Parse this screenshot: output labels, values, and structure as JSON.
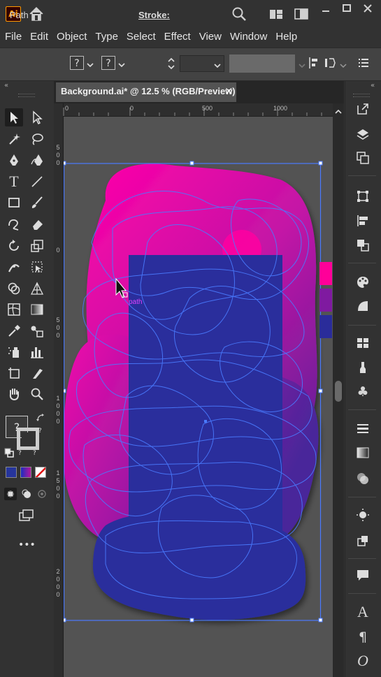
{
  "app": {
    "logo_text": "Ai",
    "title_icons": [
      "home-icon",
      "search-icon",
      "arrange-documents-icon",
      "panel-layout-icon",
      "minimize-icon",
      "maximize-icon",
      "close-icon"
    ]
  },
  "menu": {
    "items": [
      "File",
      "Edit",
      "Object",
      "Type",
      "Select",
      "Effect",
      "View",
      "Window",
      "Help"
    ]
  },
  "control_bar": {
    "selection_type": "Path",
    "fill_placeholder": "?",
    "stroke_placeholder": "?",
    "stroke_label": "Stroke:",
    "stroke_value": ""
  },
  "document": {
    "tab_title": "Background.ai* @ 12.5 % (RGB/Preview)",
    "close_glyph": "×",
    "zoom": "12.5 %",
    "color_mode": "RGB/Preview"
  },
  "rulers": {
    "horizontal": [
      "0",
      "0",
      "500",
      "1000"
    ],
    "vertical": [
      [
        "5",
        "0",
        "0"
      ],
      [
        "0"
      ],
      [
        "5",
        "0",
        "0"
      ],
      [
        "1",
        "0",
        "0",
        "0"
      ],
      [
        "1",
        "5",
        "0",
        "0"
      ],
      [
        "2",
        "0",
        "0",
        "0"
      ]
    ]
  },
  "canvas": {
    "hover_label": "path",
    "artwork_colors": {
      "magenta": "#ff00a8",
      "purple": "#7a1b9b",
      "blue": "#2a2e9c",
      "selection": "#4a7bff",
      "hover": "#e040ff"
    },
    "swatches": [
      "#ff0099",
      "#7f1aa0",
      "#2a2c9a"
    ]
  },
  "toolbar": {
    "fill_stroke_placeholder": "?",
    "color_modes": [
      "#26359c",
      "#8a2bb5",
      "none"
    ]
  },
  "colors": {
    "bg_dark": "#323232",
    "control": "#434343",
    "canvas": "#535353",
    "accent_logo": "#ff9a00"
  }
}
